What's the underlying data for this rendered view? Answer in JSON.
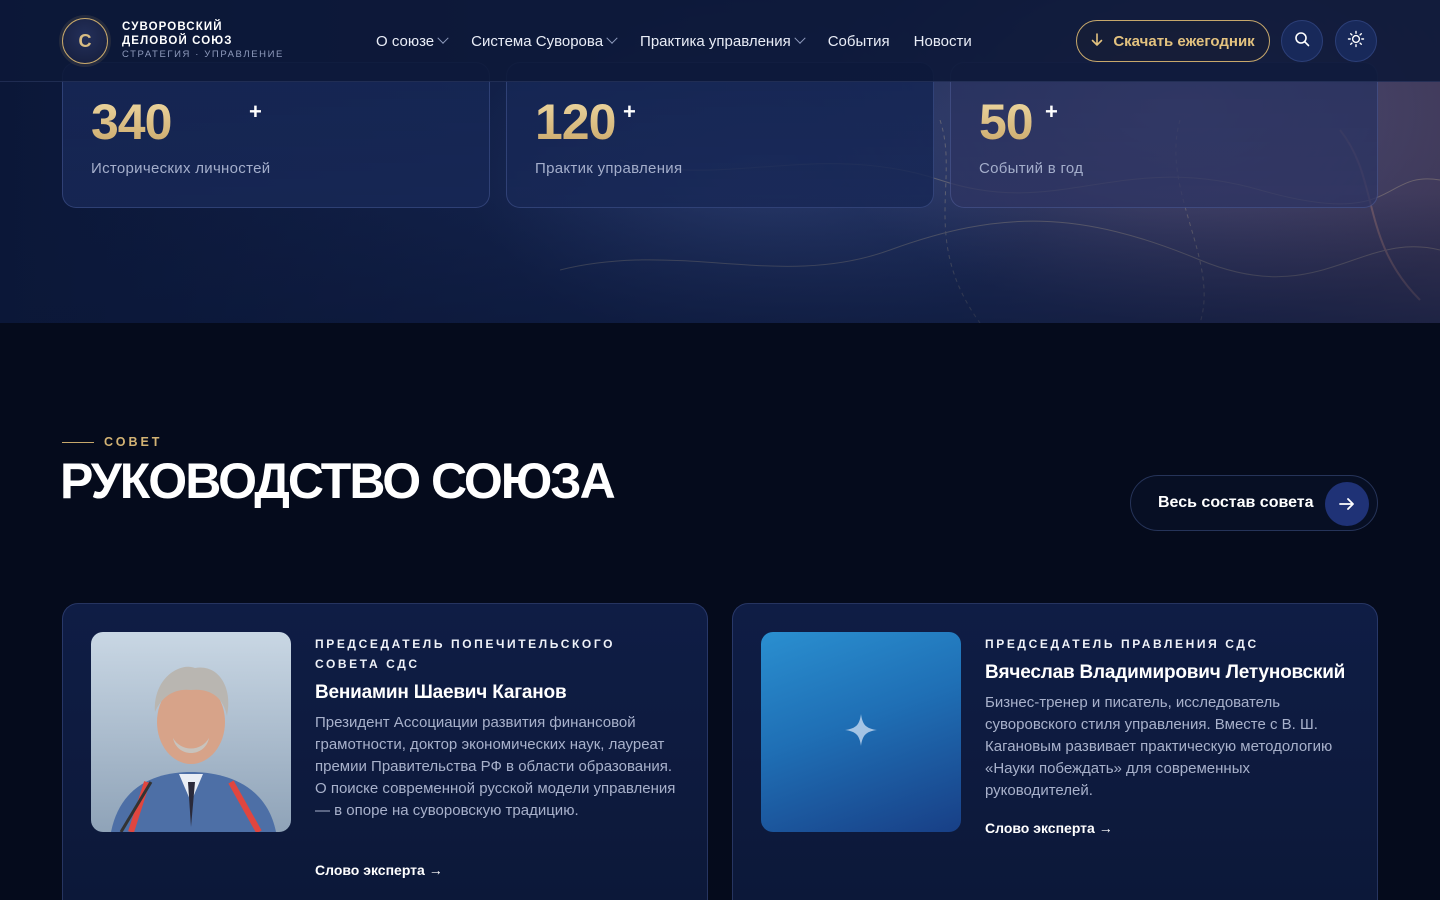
{
  "brand": {
    "logo_letter": "С",
    "line1": "СУВОРОВСКИЙ",
    "line2": "ДЕЛОВОЙ СОЮЗ",
    "line3": "СТРАТЕГИЯ · УПРАВЛЕНИЕ"
  },
  "nav": {
    "items": [
      {
        "label": "О союзе",
        "dropdown": true
      },
      {
        "label": "Система Суворова",
        "dropdown": true
      },
      {
        "label": "Практика управления",
        "dropdown": true
      },
      {
        "label": "События",
        "dropdown": false
      },
      {
        "label": "Новости",
        "dropdown": false
      }
    ]
  },
  "header_actions": {
    "download_label": "Скачать ежегодник",
    "download_icon": "arrow-down-icon",
    "search_icon": "search-icon",
    "theme_icon": "sun-icon"
  },
  "stats": [
    {
      "value": "340",
      "suffix": "+",
      "label": "Исторических личностей"
    },
    {
      "value": "120",
      "suffix": "+",
      "label": "Практик управления"
    },
    {
      "value": "50",
      "suffix": "+",
      "label": "Событий в год"
    }
  ],
  "council": {
    "eyebrow": "СОВЕТ",
    "title": "РУКОВОДСТВО СОЮЗА",
    "all_button": "Весь состав совета"
  },
  "people": [
    {
      "role": "ПРЕДСЕДАТЕЛЬ ПОПЕЧИТЕЛЬСКОГО СОВЕТА СДС",
      "name": "Вениамин Шаевич Каганов",
      "bio": "Президент Ассоциации развития финансовой грамотности, доктор экономических наук, лауреат премии Правительства РФ в области образования. О поиске современной русской модели управления — в опоре на суворовскую традицию.",
      "link": "Слово эксперта →"
    },
    {
      "role": "ПРЕДСЕДАТЕЛЬ ПРАВЛЕНИЯ СДС",
      "name": "Вячеслав Владимирович Летуновский",
      "bio": "Бизнес-тренер и писатель, исследователь суворовского стиля управления. Вместе с В. Ш. Кагановым развивает практическую методологию «Науки побеждать» для современных руководителей.",
      "link": "Слово эксперта →"
    }
  ],
  "colors": {
    "background": "#050b1c",
    "header": "#0d1838",
    "gold": "#c7a86b",
    "card": "#0f1d45",
    "accent_button": "#1f3276"
  }
}
